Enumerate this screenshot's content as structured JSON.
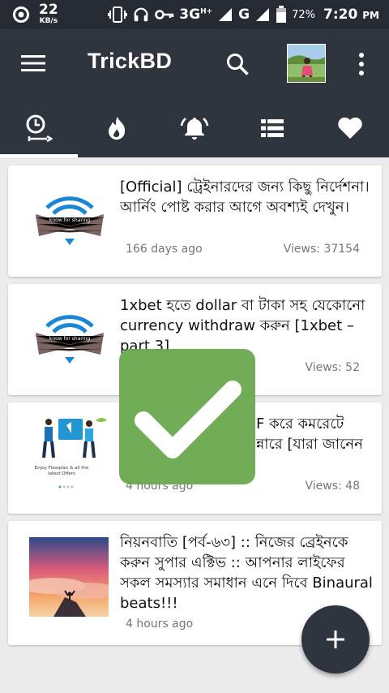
{
  "statusbar": {
    "speed_value": "22",
    "speed_unit": "KB/s",
    "network1": "3G",
    "network1_sup": "H+",
    "network2": "G",
    "battery": "72%",
    "time": "7:20",
    "ampm": "PM"
  },
  "appbar": {
    "title": "TrickBD"
  },
  "tabs": [
    "recent",
    "trending",
    "notifications",
    "categories",
    "favorites"
  ],
  "posts": [
    {
      "title": "[Official] ট্রেইনারদের জন্য কিছু নির্দেশনা।আর্নিং পোষ্ট করার আগে অবশ্যই দেখুন।",
      "time": "166 days ago",
      "views": "Views: 37154",
      "thumb_label": "know for sharing"
    },
    {
      "title": "1xbet হতে dollar বা টাকা সহ যেকোনো currency withdraw করুন [1xbet – part 3]",
      "time": "",
      "views": "Views: 52",
      "thumb_label": "know for sharing"
    },
    {
      "title": "F করে কমরেটে ন্নারে [যারা জানেন",
      "time": "4 hours ago",
      "views": "Views: 48",
      "thumb_label": "Enjoy Flexiplan & all the latest Offers"
    },
    {
      "title": "নিয়নবাতি [পর্ব-৬৩] :: নিজের ব্রেইনকে করুন সুপার এক্টিভ :: আপনার লাইফের সকল সমস্যার সমাধান এনে দিবে Binaural beats!!!",
      "time": "4 hours ago",
      "views": ""
    }
  ],
  "colors": {
    "appbar": "#2f353e",
    "statusbar": "#262b33",
    "overlay": "#6aa84f"
  }
}
